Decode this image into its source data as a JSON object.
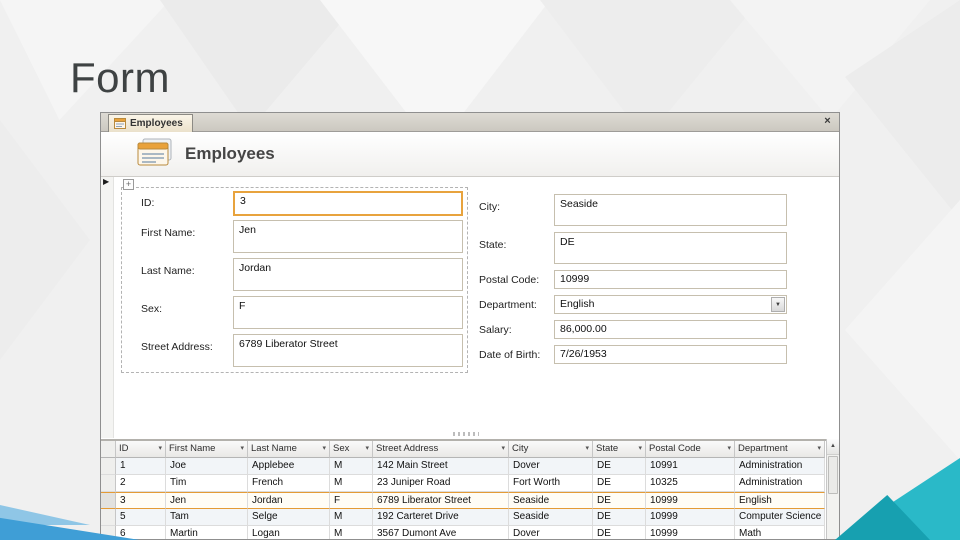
{
  "slide": {
    "title": "Form"
  },
  "icons": {
    "close": "×",
    "record_arrow": "▶",
    "filter_arrow": "▾",
    "combo_arrow": "▼",
    "scroll_up_arrow": "▲",
    "move_handle": "+"
  },
  "window": {
    "tab": {
      "label": "Employees"
    },
    "header": {
      "title": "Employees"
    },
    "form": {
      "fields_left": [
        {
          "label": "ID:",
          "value": "3"
        },
        {
          "label": "First Name:",
          "value": "Jen"
        },
        {
          "label": "Last Name:",
          "value": "Jordan"
        },
        {
          "label": "Sex:",
          "value": "F"
        },
        {
          "label": "Street Address:",
          "value": "6789 Liberator Street"
        }
      ],
      "fields_right": [
        {
          "label": "City:",
          "value": "Seaside"
        },
        {
          "label": "State:",
          "value": "DE"
        },
        {
          "label": "Postal Code:",
          "value": "10999"
        },
        {
          "label": "Department:",
          "value": "English"
        },
        {
          "label": "Salary:",
          "value": "86,000.00"
        },
        {
          "label": "Date of Birth:",
          "value": "7/26/1953"
        }
      ]
    },
    "datasheet": {
      "columns": [
        "ID",
        "First Name",
        "Last Name",
        "Sex",
        "Street Address",
        "City",
        "State",
        "Postal Code",
        "Department"
      ],
      "rows": [
        [
          "1",
          "Joe",
          "Applebee",
          "M",
          "142 Main Street",
          "Dover",
          "DE",
          "10991",
          "Administration"
        ],
        [
          "2",
          "Tim",
          "French",
          "M",
          "23 Juniper Road",
          "Fort Worth",
          "DE",
          "10325",
          "Administration"
        ],
        [
          "3",
          "Jen",
          "Jordan",
          "F",
          "6789 Liberator Street",
          "Seaside",
          "DE",
          "10999",
          "English"
        ],
        [
          "5",
          "Tam",
          "Selge",
          "M",
          "192 Carteret Drive",
          "Seaside",
          "DE",
          "10999",
          "Computer Science"
        ],
        [
          "6",
          "Martin",
          "Logan",
          "M",
          "3567 Dumont Ave",
          "Dover",
          "DE",
          "10999",
          "Math"
        ]
      ]
    }
  },
  "colors": {
    "accent_orange": "#e8a33d",
    "teal_light": "#2ab9c8",
    "teal_dark": "#17a0b0",
    "blue": "#3f9ed6"
  }
}
